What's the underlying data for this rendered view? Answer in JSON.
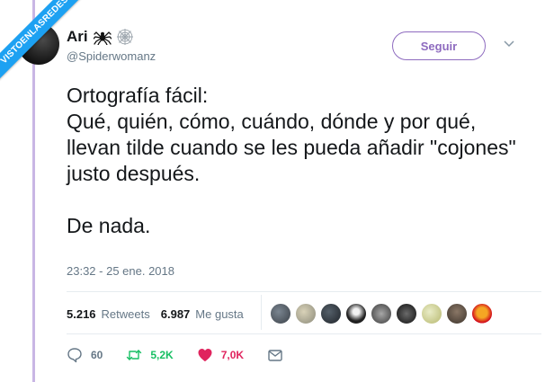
{
  "watermark": "VISTOENLASREDES",
  "author": {
    "display_name": "Ari",
    "handle": "@Spiderwomanz"
  },
  "follow_label": "Seguir",
  "tweet_text": "Ortografía fácil:\nQué, quién, cómo, cuándo, dónde y por qué, llevan tilde cuando se les pueda añadir \"cojones\" justo después.\n\nDe nada.",
  "timestamp": "23:32 - 25 ene. 2018",
  "stats": {
    "retweets_count": "5.216",
    "retweets_label": "Retweets",
    "likes_count": "6.987",
    "likes_label": "Me gusta"
  },
  "actions": {
    "reply_count": "60",
    "retweet_count": "5,2K",
    "like_count": "7,0K"
  },
  "colors": {
    "accent": "#8e6bbf",
    "retweet": "#17bf63",
    "like": "#e0245e",
    "muted": "#657786"
  },
  "icons": [
    "spider-icon",
    "spider-web-icon",
    "chevron-down-icon",
    "reply-icon",
    "retweet-icon",
    "heart-icon",
    "message-icon"
  ]
}
